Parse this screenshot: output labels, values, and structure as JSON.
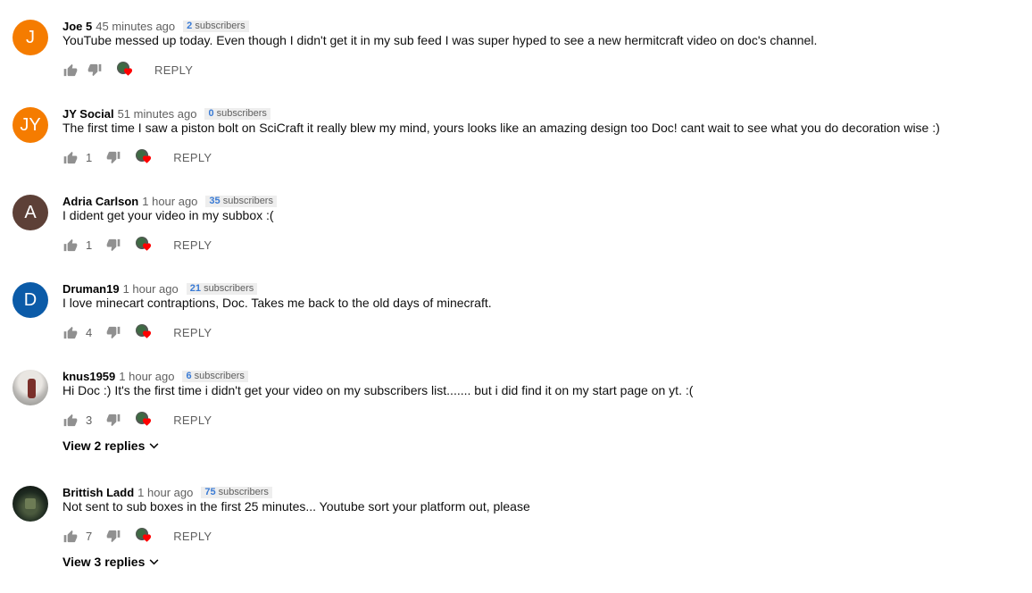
{
  "ui": {
    "reply_label": "REPLY",
    "colors": {
      "link_blue": "#3a7bd5",
      "meta_gray": "#606060",
      "heart_red": "#ff0000"
    },
    "icons": {
      "like": "thumbs-up-icon",
      "dislike": "thumbs-down-icon",
      "creator_heart": "creator-heart-icon",
      "expand": "chevron-down-icon"
    }
  },
  "comments": [
    {
      "author": "Joe 5",
      "time": "45 minutes ago",
      "sub_count": "2",
      "sub_label": "subscribers",
      "text": "YouTube messed up today. Even though I didn't get it in my sub feed I was super hyped to see a new hermitcraft video on doc's channel.",
      "likes": "",
      "avatar_letter": "J",
      "avatar_color": "#f57c00",
      "view_replies": ""
    },
    {
      "author": "JY Social",
      "time": "51 minutes ago",
      "sub_count": "0",
      "sub_label": "subscribers",
      "text": "The first time I saw a piston bolt on SciCraft it really blew my mind, yours looks like an amazing design too Doc! cant wait to see what you do decoration wise :)",
      "likes": "1",
      "avatar_letter": "JY",
      "avatar_color": "#f57c00",
      "view_replies": ""
    },
    {
      "author": "Adria Carlson",
      "time": "1 hour ago",
      "sub_count": "35",
      "sub_label": "subscribers",
      "text": "I dident get your video in my subbox :(",
      "likes": "1",
      "avatar_letter": "A",
      "avatar_color": "#5d4037",
      "view_replies": ""
    },
    {
      "author": "Druman19",
      "time": "1 hour ago",
      "sub_count": "21",
      "sub_label": "subscribers",
      "text": "I love minecart contraptions, Doc.  Takes me back to the old days of minecraft.",
      "likes": "4",
      "avatar_letter": "D",
      "avatar_color": "#0b5ba8",
      "view_replies": ""
    },
    {
      "author": "knus1959",
      "time": "1 hour ago",
      "sub_count": "6",
      "sub_label": "subscribers",
      "text": "Hi Doc :)  It's the first time i didn't get your video on my subscribers list....... but i did find it on my start page on yt.  :(",
      "likes": "3",
      "avatar_letter": "",
      "avatar_color": "",
      "view_replies": "View 2 replies"
    },
    {
      "author": "Brittish Ladd",
      "time": "1 hour ago",
      "sub_count": "75",
      "sub_label": "subscribers",
      "text": "Not sent to sub boxes in the first 25 minutes... Youtube sort your platform out, please",
      "likes": "7",
      "avatar_letter": "",
      "avatar_color": "",
      "view_replies": "View 3 replies"
    }
  ]
}
